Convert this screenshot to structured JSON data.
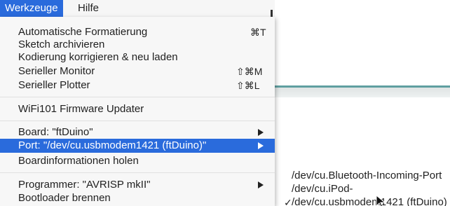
{
  "menubar": {
    "items": [
      {
        "label": "Werkzeuge"
      },
      {
        "label": "Hilfe"
      }
    ]
  },
  "menu": {
    "items": [
      {
        "label": "Automatische Formatierung",
        "shortcut": "⌘T"
      },
      {
        "label": "Sketch archivieren",
        "shortcut": ""
      },
      {
        "label": "Kodierung korrigieren & neu laden",
        "shortcut": ""
      },
      {
        "label": "Serieller Monitor",
        "shortcut": "⇧⌘M"
      },
      {
        "label": "Serieller Plotter",
        "shortcut": "⇧⌘L"
      },
      {
        "label": "WiFi101 Firmware Updater",
        "shortcut": ""
      },
      {
        "label": "Board: \"ftDuino\"",
        "shortcut": ""
      },
      {
        "label": "Port: \"/dev/cu.usbmodem1421 (ftDuino)\"",
        "shortcut": ""
      },
      {
        "label": "Boardinformationen holen",
        "shortcut": ""
      },
      {
        "label": "Programmer: \"AVRISP mkII\"",
        "shortcut": ""
      },
      {
        "label": "Bootloader brennen",
        "shortcut": ""
      }
    ]
  },
  "port_submenu": {
    "items": [
      {
        "label": "/dev/cu.Bluetooth-Incoming-Port",
        "check": ""
      },
      {
        "label": "/dev/cu.iPod-",
        "check": ""
      },
      {
        "label": "/dev/cu.usbmodem1421 (ftDuino)",
        "check": "✓"
      }
    ]
  },
  "colors": {
    "highlight": "#2a6bdc",
    "menu_bg": "#f7f7f7",
    "window_accent": "#5f9fa0"
  }
}
